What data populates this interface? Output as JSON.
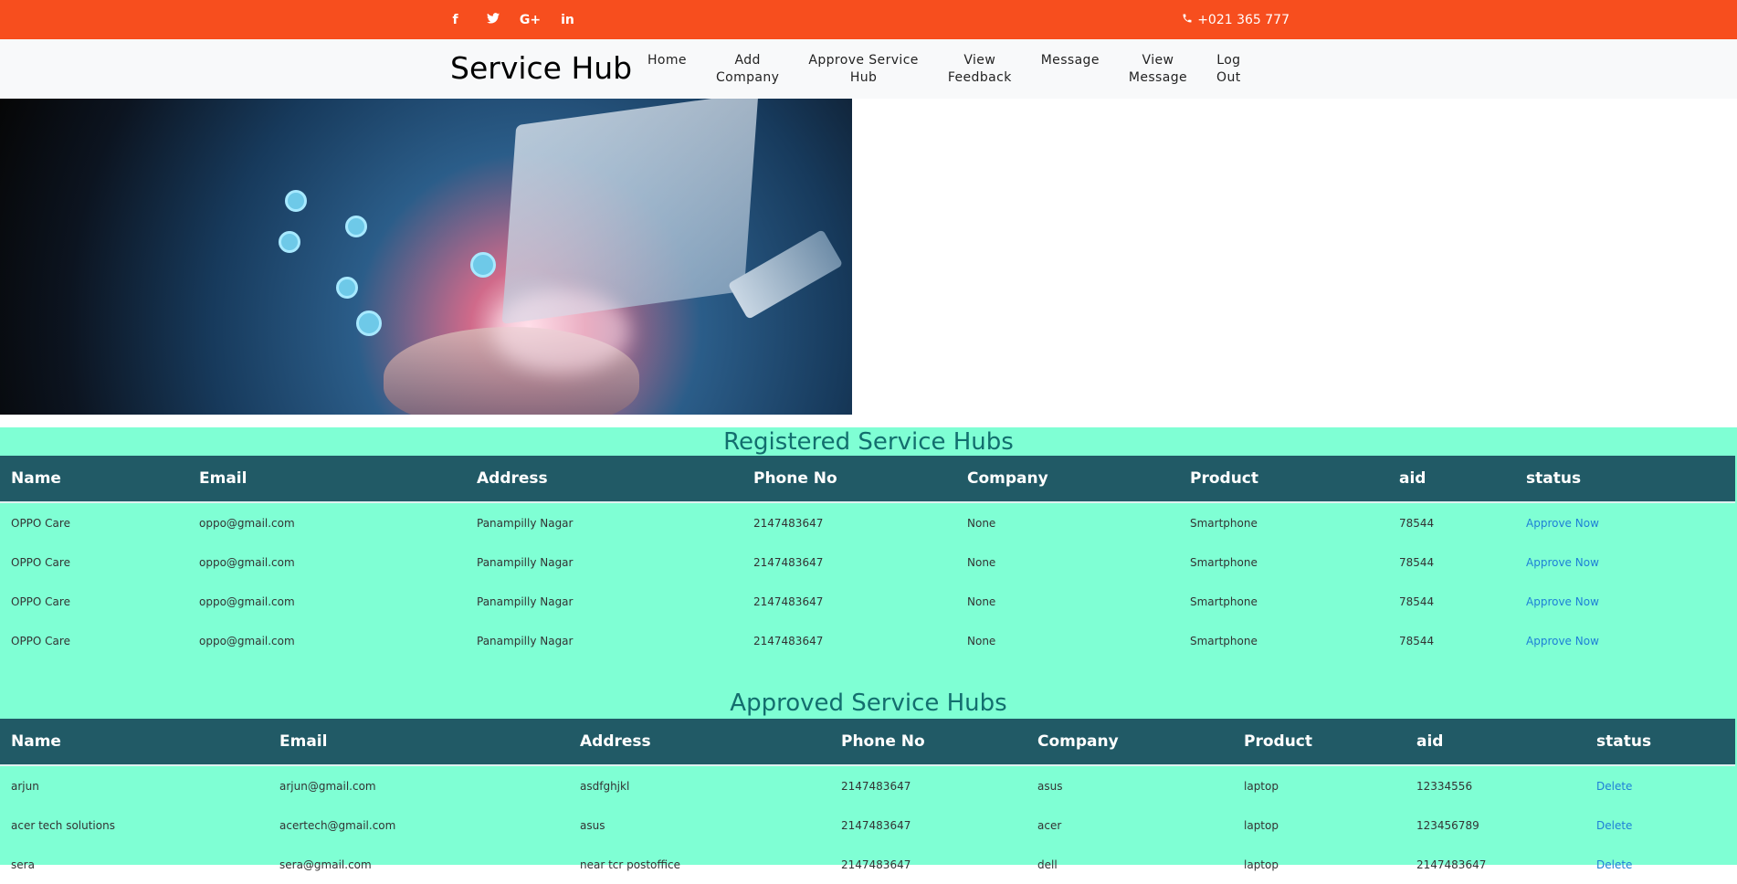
{
  "topbar": {
    "social": [
      {
        "icon": "facebook-icon",
        "glyph": "f"
      },
      {
        "icon": "twitter-icon",
        "glyph": "🐦"
      },
      {
        "icon": "google-plus-icon",
        "glyph": "G+"
      },
      {
        "icon": "linkedin-icon",
        "glyph": "in"
      }
    ],
    "phone": "+021 365 777",
    "color": "#f74e1e"
  },
  "nav": {
    "brand": "Service Hub",
    "items": [
      {
        "line1": "Home",
        "line2": ""
      },
      {
        "line1": "Add",
        "line2": "Company"
      },
      {
        "line1": "Approve Service",
        "line2": "Hub"
      },
      {
        "line1": "View",
        "line2": "Feedback"
      },
      {
        "line1": "Message",
        "line2": ""
      },
      {
        "line1": "View",
        "line2": "Message"
      },
      {
        "line1": "Log",
        "line2": "Out"
      }
    ]
  },
  "registered": {
    "title": "Registered Service Hubs",
    "headers": [
      "Name",
      "Email",
      "Address",
      "Phone No",
      "Company",
      "Product",
      "aid",
      "status"
    ],
    "rows": [
      [
        "OPPO Care",
        "oppo@gmail.com",
        "Panampilly Nagar",
        "2147483647",
        "None",
        "Smartphone",
        "78544",
        "Approve Now"
      ],
      [
        "OPPO Care",
        "oppo@gmail.com",
        "Panampilly Nagar",
        "2147483647",
        "None",
        "Smartphone",
        "78544",
        "Approve Now"
      ],
      [
        "OPPO Care",
        "oppo@gmail.com",
        "Panampilly Nagar",
        "2147483647",
        "None",
        "Smartphone",
        "78544",
        "Approve Now"
      ],
      [
        "OPPO Care",
        "oppo@gmail.com",
        "Panampilly Nagar",
        "2147483647",
        "None",
        "Smartphone",
        "78544",
        "Approve Now"
      ]
    ]
  },
  "approved": {
    "title": "Approved Service Hubs",
    "headers": [
      "Name",
      "Email",
      "Address",
      "Phone No",
      "Company",
      "Product",
      "aid",
      "status"
    ],
    "rows": [
      [
        "arjun",
        "arjun@gmail.com",
        "asdfghjkl",
        "2147483647",
        "asus",
        "laptop",
        "12334556",
        "Delete"
      ],
      [
        "acer tech solutions",
        "acertech@gmail.com",
        "asus",
        "2147483647",
        "acer",
        "laptop",
        "123456789",
        "Delete"
      ],
      [
        "sera",
        "sera@gmail.com",
        "near tcr postoffice",
        "2147483647",
        "dell",
        "laptop",
        "2147483647",
        "Delete"
      ]
    ]
  },
  "colors": {
    "table_bg": "#7fffd4",
    "header_bg": "#215a66",
    "heading": "#136e6e",
    "link": "#1e7fd6"
  }
}
